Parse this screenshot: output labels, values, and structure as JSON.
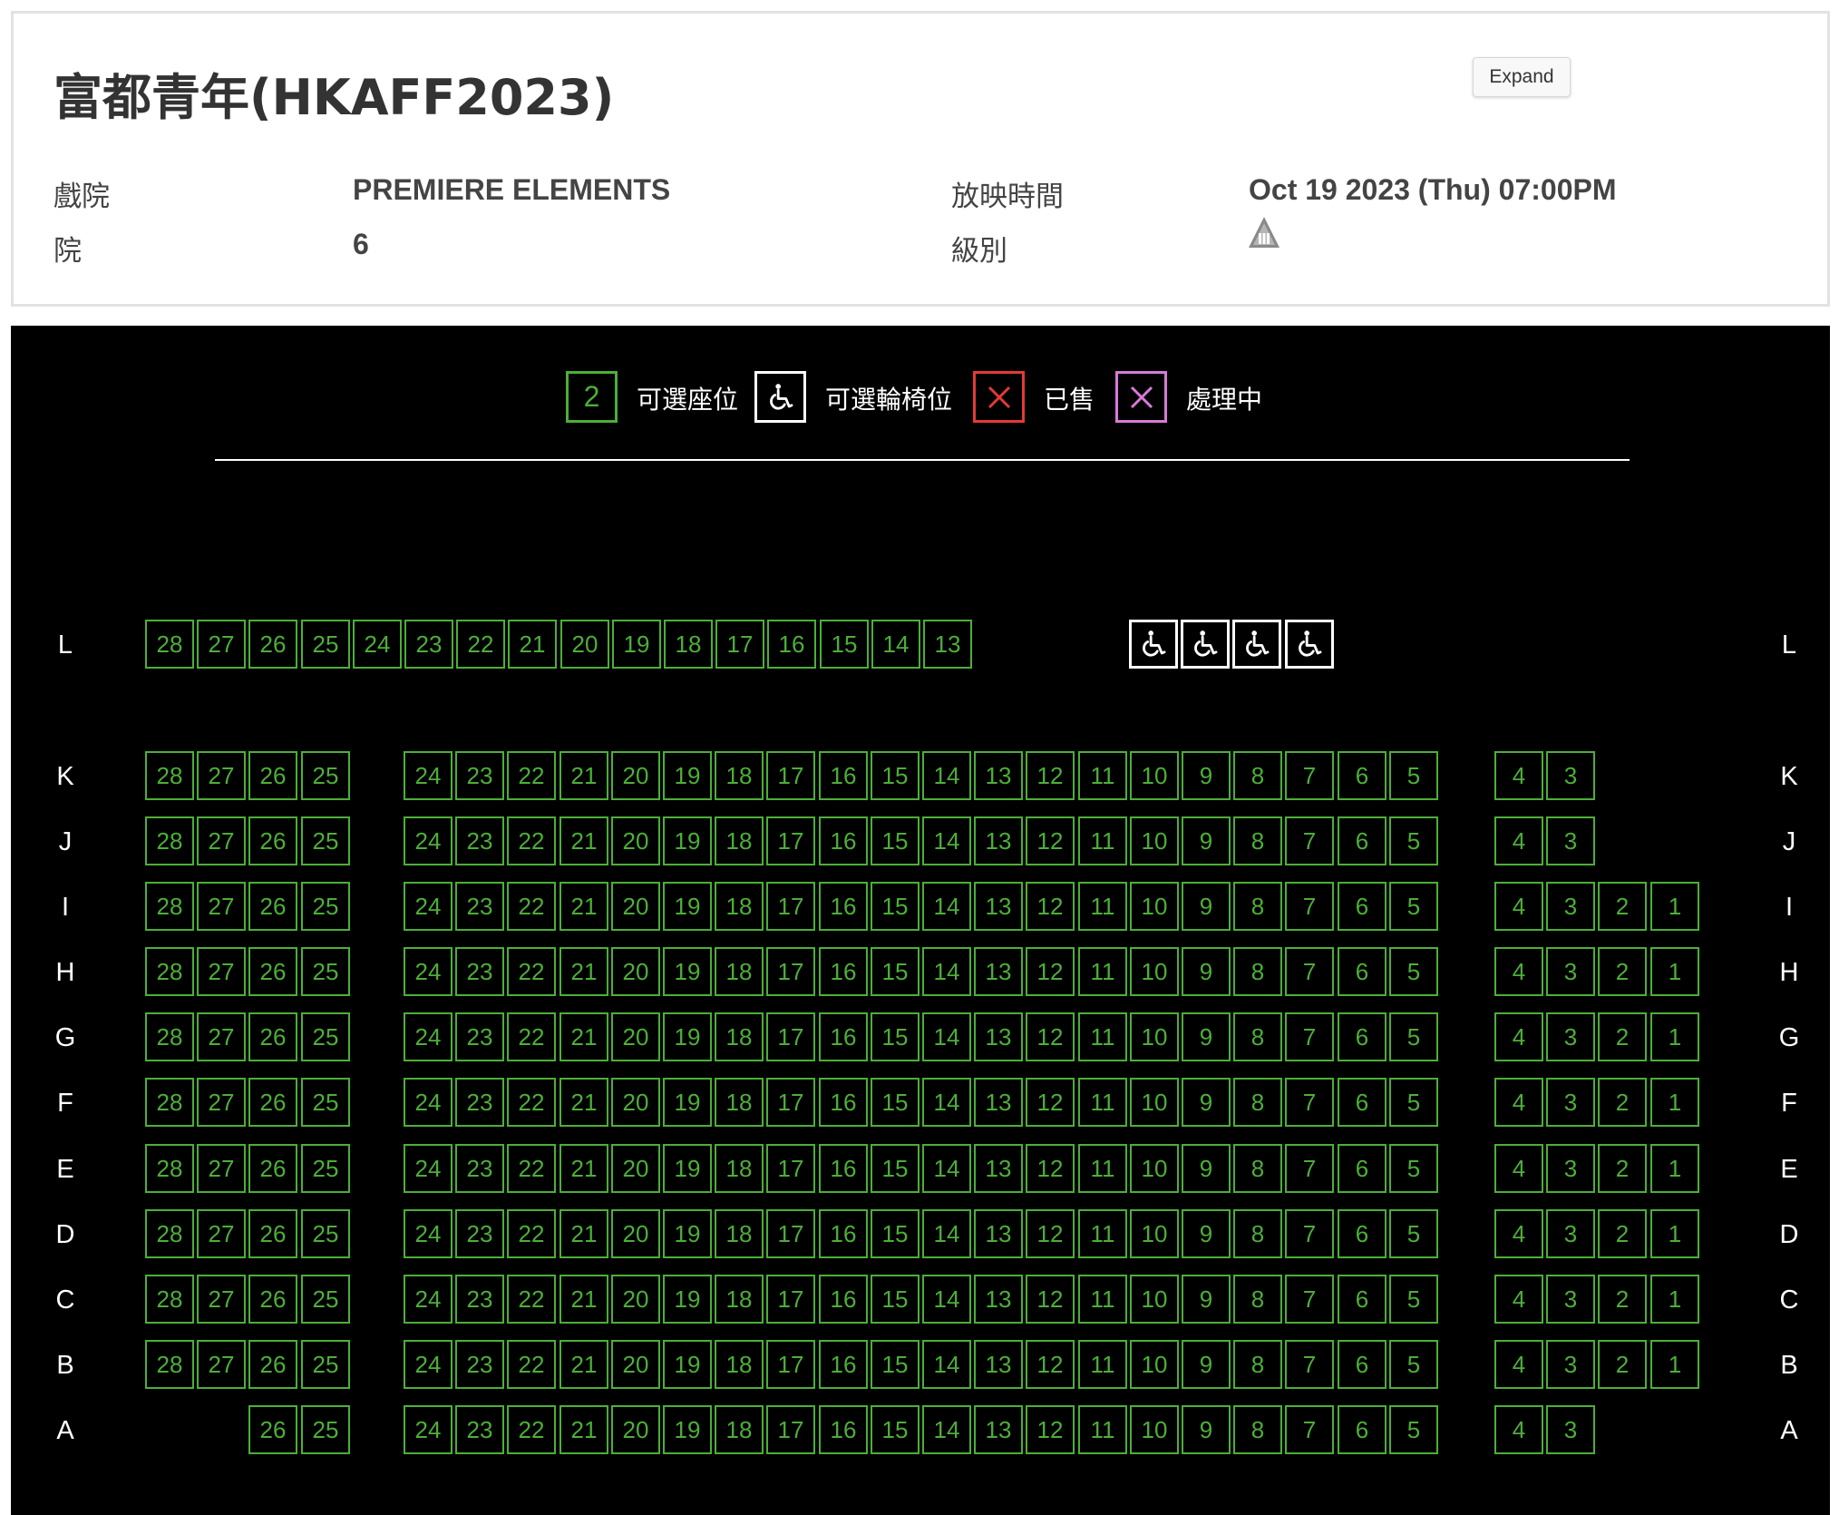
{
  "header": {
    "title": "富都青年(HKAFF2023)",
    "expand_label": "Expand",
    "cinema_label": "戲院",
    "cinema_value": "PREMIERE ELEMENTS",
    "house_label": "院",
    "house_value": "6",
    "showtime_label": "放映時間",
    "showtime_value": "Oct 19 2023 (Thu) 07:00PM",
    "rating_label": "級別",
    "rating_icon": "category-iii-icon"
  },
  "legend": {
    "available_number": "2",
    "available_label": "可選座位",
    "wheelchair_label": "可選輪椅位",
    "sold_label": "已售",
    "processing_label": "處理中"
  },
  "colors": {
    "available": "#4caf38",
    "wheelchair": "#ffffff",
    "sold": "#e53935",
    "processing": "#d87ad8",
    "background": "#000000"
  },
  "rows": [
    {
      "label": "L",
      "left": [
        "28",
        "27",
        "26",
        "25",
        "24",
        "23",
        "22",
        "21",
        "20",
        "19",
        "18",
        "17",
        "16",
        "15",
        "14",
        "13"
      ],
      "middle": [],
      "right": [],
      "wheelchair": 4
    },
    {
      "label": "K",
      "left": [
        "28",
        "27",
        "26",
        "25"
      ],
      "middle": [
        "24",
        "23",
        "22",
        "21",
        "20",
        "19",
        "18",
        "17",
        "16",
        "15",
        "14",
        "13",
        "12",
        "11",
        "10",
        "9",
        "8",
        "7",
        "6",
        "5"
      ],
      "right": [
        "4",
        "3"
      ],
      "wheelchair": 0
    },
    {
      "label": "J",
      "left": [
        "28",
        "27",
        "26",
        "25"
      ],
      "middle": [
        "24",
        "23",
        "22",
        "21",
        "20",
        "19",
        "18",
        "17",
        "16",
        "15",
        "14",
        "13",
        "12",
        "11",
        "10",
        "9",
        "8",
        "7",
        "6",
        "5"
      ],
      "right": [
        "4",
        "3"
      ],
      "wheelchair": 0
    },
    {
      "label": "I",
      "left": [
        "28",
        "27",
        "26",
        "25"
      ],
      "middle": [
        "24",
        "23",
        "22",
        "21",
        "20",
        "19",
        "18",
        "17",
        "16",
        "15",
        "14",
        "13",
        "12",
        "11",
        "10",
        "9",
        "8",
        "7",
        "6",
        "5"
      ],
      "right": [
        "4",
        "3",
        "2",
        "1"
      ],
      "wheelchair": 0
    },
    {
      "label": "H",
      "left": [
        "28",
        "27",
        "26",
        "25"
      ],
      "middle": [
        "24",
        "23",
        "22",
        "21",
        "20",
        "19",
        "18",
        "17",
        "16",
        "15",
        "14",
        "13",
        "12",
        "11",
        "10",
        "9",
        "8",
        "7",
        "6",
        "5"
      ],
      "right": [
        "4",
        "3",
        "2",
        "1"
      ],
      "wheelchair": 0
    },
    {
      "label": "G",
      "left": [
        "28",
        "27",
        "26",
        "25"
      ],
      "middle": [
        "24",
        "23",
        "22",
        "21",
        "20",
        "19",
        "18",
        "17",
        "16",
        "15",
        "14",
        "13",
        "12",
        "11",
        "10",
        "9",
        "8",
        "7",
        "6",
        "5"
      ],
      "right": [
        "4",
        "3",
        "2",
        "1"
      ],
      "wheelchair": 0
    },
    {
      "label": "F",
      "left": [
        "28",
        "27",
        "26",
        "25"
      ],
      "middle": [
        "24",
        "23",
        "22",
        "21",
        "20",
        "19",
        "18",
        "17",
        "16",
        "15",
        "14",
        "13",
        "12",
        "11",
        "10",
        "9",
        "8",
        "7",
        "6",
        "5"
      ],
      "right": [
        "4",
        "3",
        "2",
        "1"
      ],
      "wheelchair": 0
    },
    {
      "label": "E",
      "left": [
        "28",
        "27",
        "26",
        "25"
      ],
      "middle": [
        "24",
        "23",
        "22",
        "21",
        "20",
        "19",
        "18",
        "17",
        "16",
        "15",
        "14",
        "13",
        "12",
        "11",
        "10",
        "9",
        "8",
        "7",
        "6",
        "5"
      ],
      "right": [
        "4",
        "3",
        "2",
        "1"
      ],
      "wheelchair": 0
    },
    {
      "label": "D",
      "left": [
        "28",
        "27",
        "26",
        "25"
      ],
      "middle": [
        "24",
        "23",
        "22",
        "21",
        "20",
        "19",
        "18",
        "17",
        "16",
        "15",
        "14",
        "13",
        "12",
        "11",
        "10",
        "9",
        "8",
        "7",
        "6",
        "5"
      ],
      "right": [
        "4",
        "3",
        "2",
        "1"
      ],
      "wheelchair": 0
    },
    {
      "label": "C",
      "left": [
        "28",
        "27",
        "26",
        "25"
      ],
      "middle": [
        "24",
        "23",
        "22",
        "21",
        "20",
        "19",
        "18",
        "17",
        "16",
        "15",
        "14",
        "13",
        "12",
        "11",
        "10",
        "9",
        "8",
        "7",
        "6",
        "5"
      ],
      "right": [
        "4",
        "3",
        "2",
        "1"
      ],
      "wheelchair": 0
    },
    {
      "label": "B",
      "left": [
        "28",
        "27",
        "26",
        "25"
      ],
      "middle": [
        "24",
        "23",
        "22",
        "21",
        "20",
        "19",
        "18",
        "17",
        "16",
        "15",
        "14",
        "13",
        "12",
        "11",
        "10",
        "9",
        "8",
        "7",
        "6",
        "5"
      ],
      "right": [
        "4",
        "3",
        "2",
        "1"
      ],
      "wheelchair": 0
    },
    {
      "label": "A",
      "left": [
        "26",
        "25"
      ],
      "middle": [
        "24",
        "23",
        "22",
        "21",
        "20",
        "19",
        "18",
        "17",
        "16",
        "15",
        "14",
        "13",
        "12",
        "11",
        "10",
        "9",
        "8",
        "7",
        "6",
        "5"
      ],
      "right": [
        "4",
        "3"
      ],
      "wheelchair": 0
    }
  ]
}
